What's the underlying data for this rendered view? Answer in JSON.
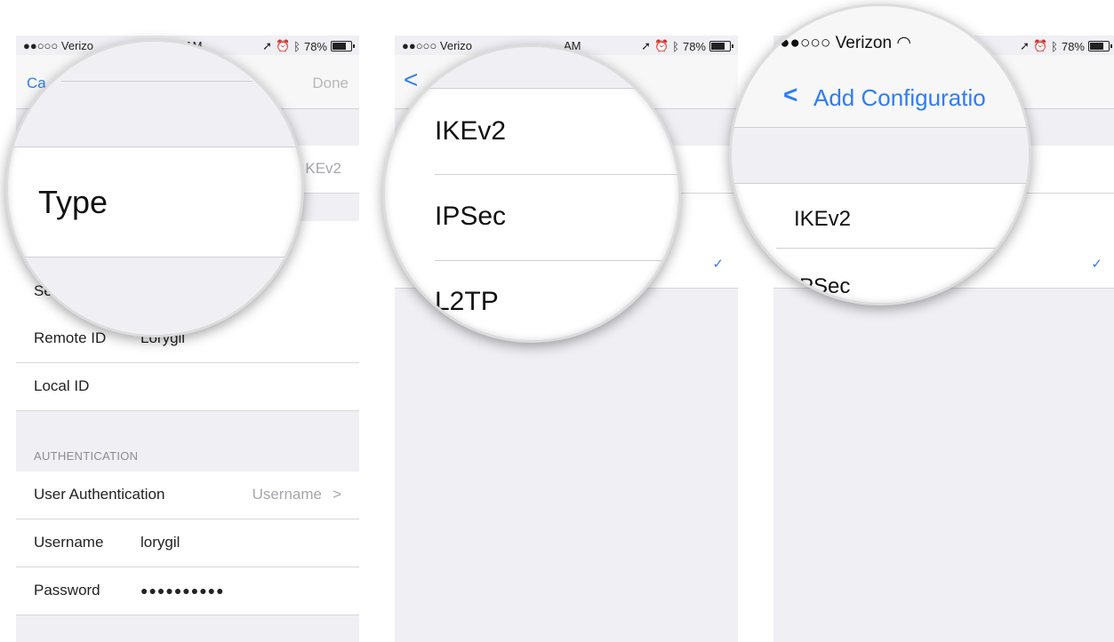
{
  "status": {
    "carrier_signal": "●●○○○",
    "carrier": "Verizon",
    "time": "AM",
    "icons": [
      "location-icon",
      "alarm-icon",
      "bluetooth-icon"
    ],
    "battery": "78%"
  },
  "panel1": {
    "cancel_label": "Ca",
    "done_label": "Done",
    "type_value": "KEv2",
    "server_label": "Se",
    "remote_id_label": "Remote ID",
    "remote_id_value": "Lorygil",
    "local_id_label": "Local ID",
    "auth_header": "AUTHENTICATION",
    "user_auth_label": "User Authentication",
    "user_auth_value": "Username",
    "user_auth_chevron": ">",
    "username_label": "Username",
    "username_value": "lorygil",
    "password_label": "Password",
    "password_value": "●●●●●●●●●●",
    "magnifier_label": "Type"
  },
  "panel2": {
    "carrier": "Verizo",
    "time": "AM",
    "back_chevron": "<",
    "options": [
      "IKEv2",
      "IPSec",
      "L2TP"
    ],
    "check": "✓"
  },
  "panel3": {
    "carrier_signal": "●●○○○",
    "carrier": "Verizon",
    "back_label": "Add Configuratio",
    "back_chevron": "<",
    "options": [
      "IKEv2",
      "PSec"
    ],
    "check": "✓"
  }
}
